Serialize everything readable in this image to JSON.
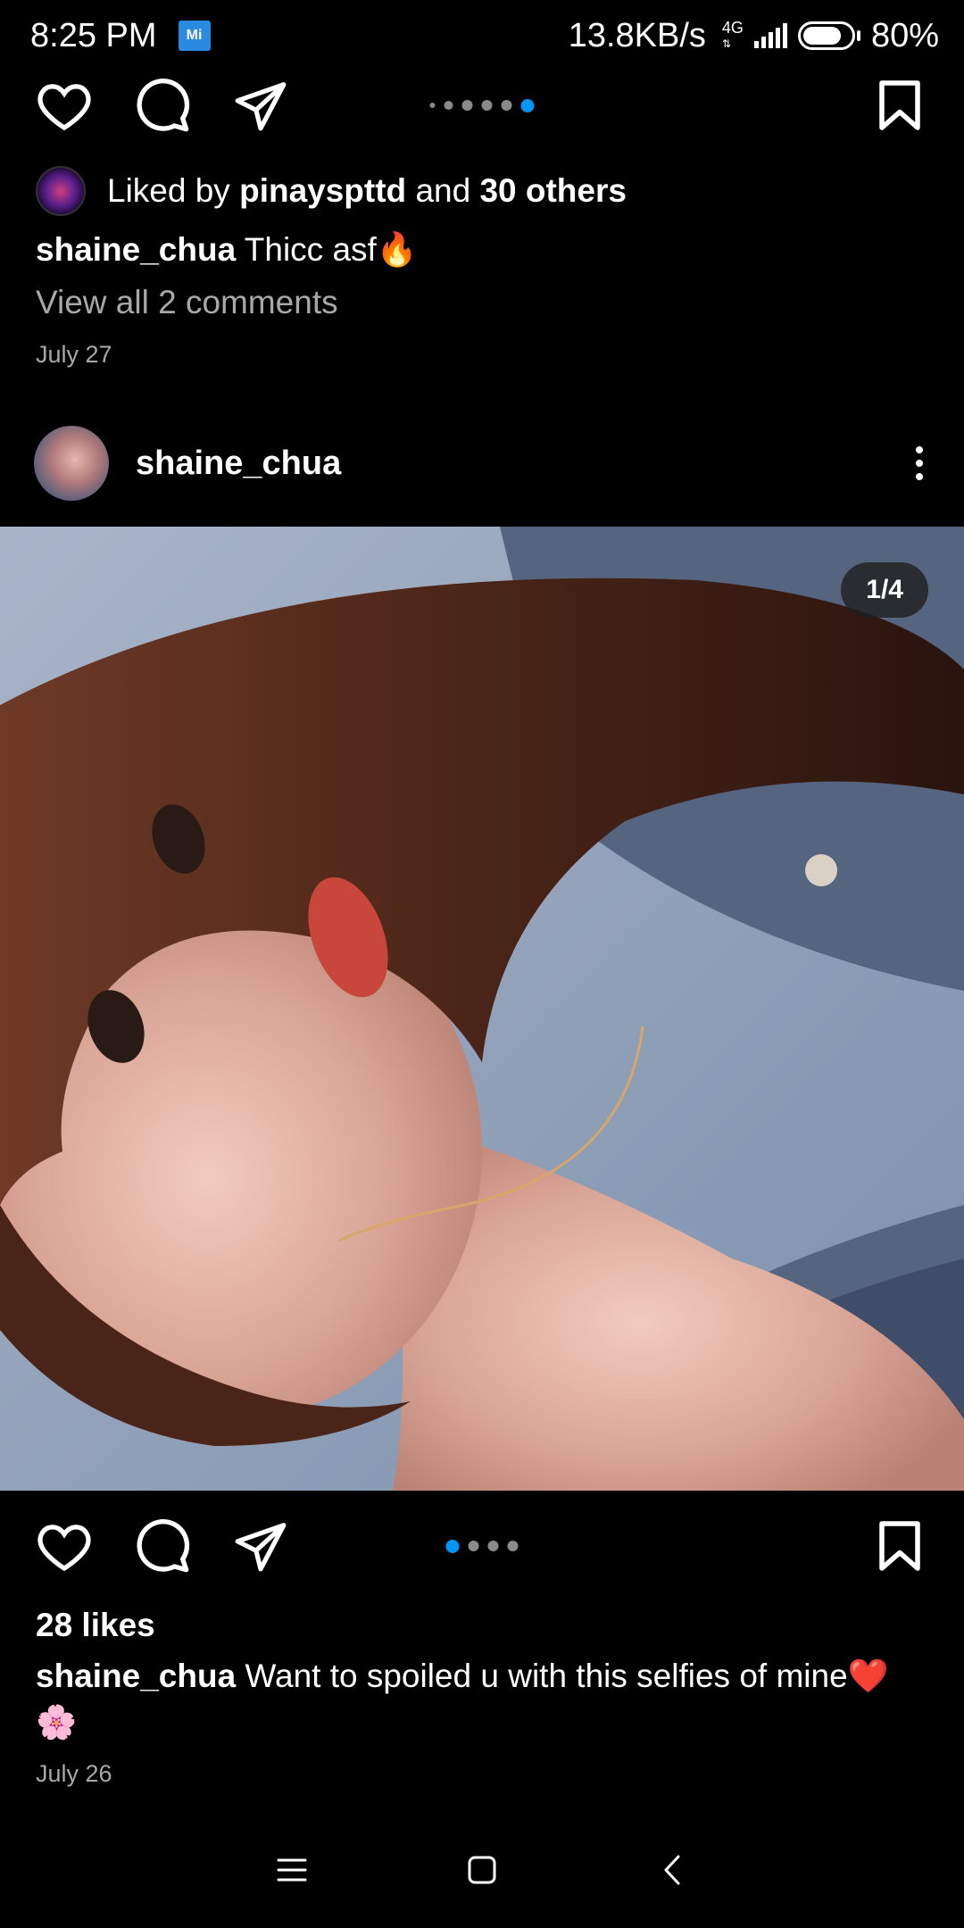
{
  "status_bar": {
    "time": "8:25 PM",
    "network_speed": "13.8KB/s",
    "network_type": "4G",
    "battery": "80%",
    "battery_level": 0.8
  },
  "previous_post": {
    "carousel_dots": 6,
    "carousel_active_index": 5,
    "liked_by_prefix": "Liked by",
    "liked_by_user": "pinayspttd",
    "liked_by_and": "and",
    "liked_by_others": "30 others",
    "caption_user": "shaine_chua",
    "caption_text": "Thicc asf🔥",
    "view_comments": "View all 2 comments",
    "date": "July 27"
  },
  "post": {
    "username": "shaine_chua",
    "image_counter": "1/4",
    "carousel_dots": 4,
    "carousel_active_index": 0,
    "likes": "28 likes",
    "caption_user": "shaine_chua",
    "caption_text": "Want to spoiled u with this selfies of mine❤️🌸",
    "date": "July 26"
  },
  "icons": {
    "like": "heart-icon",
    "comment": "comment-icon",
    "share": "paper-plane-icon",
    "save": "bookmark-icon",
    "more": "more-vertical-icon",
    "nav_menu": "menu-icon",
    "nav_home": "square-home-icon",
    "nav_back": "back-chevron-icon"
  },
  "colors": {
    "accent": "#0095f6",
    "secondary_text": "#a8a8a8"
  }
}
